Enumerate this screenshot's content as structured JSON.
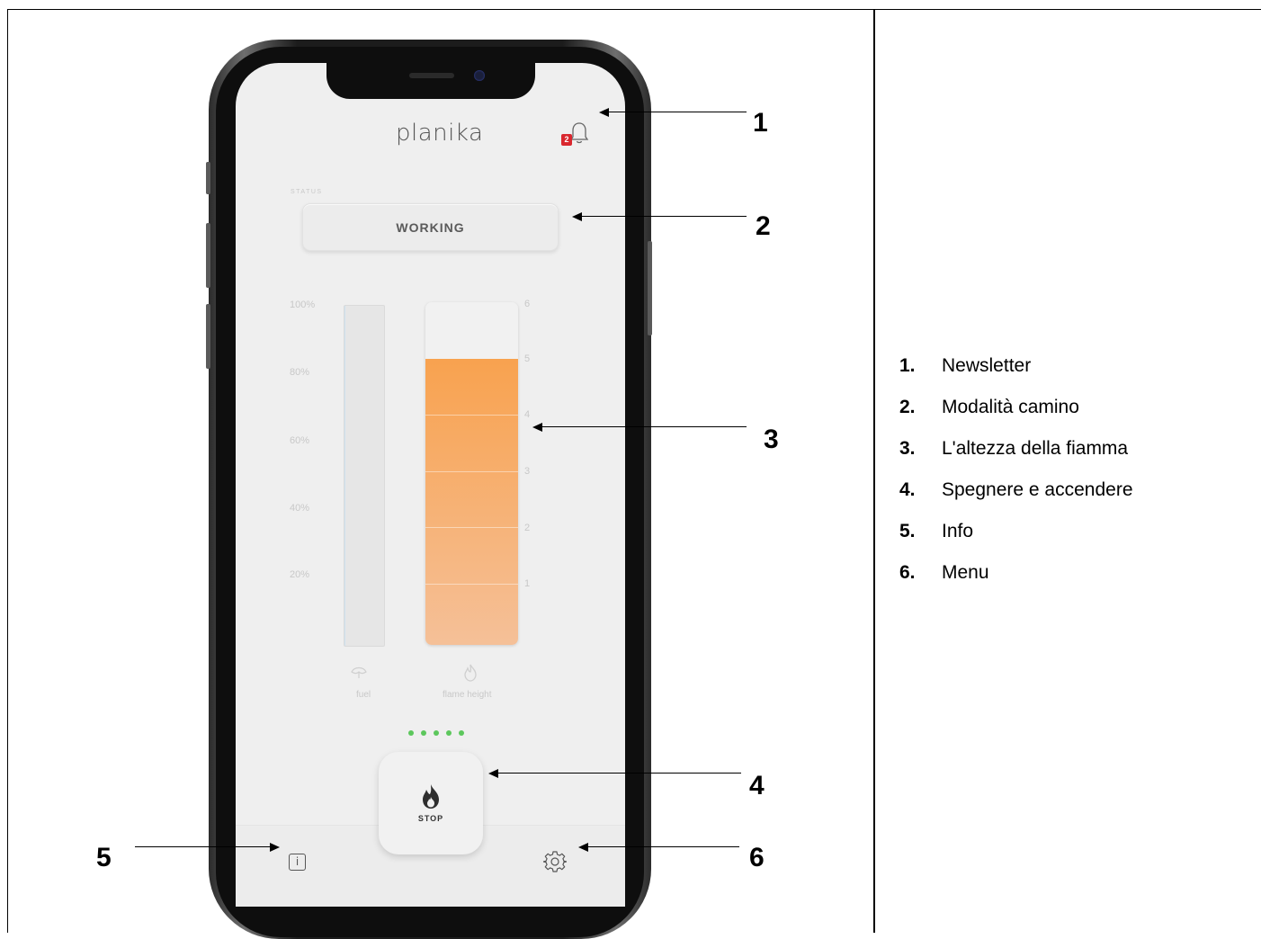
{
  "app": {
    "logo": "planika",
    "notification_count": "2",
    "status_label": "STATUS",
    "status_value": "WORKING",
    "fuel_ticks": [
      "100%",
      "80%",
      "60%",
      "40%",
      "20%"
    ],
    "flame_ticks": [
      "6",
      "5",
      "4",
      "3",
      "2",
      "1"
    ],
    "fuel_label": "fuel",
    "flame_label": "flame height",
    "fuel_level": 0,
    "flame_height": 5,
    "flame_max": 6,
    "stop_label": "STOP",
    "info_glyph": "i",
    "progress_dots": 5,
    "colors": {
      "flame_top": "#f8a24f",
      "flame_bottom": "#f5c098",
      "dot": "#5cc75c",
      "badge": "#d9272e"
    },
    "icons": [
      "bell-icon",
      "drop-icon",
      "flame-icon",
      "info-icon",
      "gear-icon"
    ]
  },
  "callouts": [
    "1",
    "2",
    "3",
    "4",
    "5",
    "6"
  ],
  "legend": [
    {
      "num": "1.",
      "text": "Newsletter"
    },
    {
      "num": "2.",
      "text": "Modalità camino"
    },
    {
      "num": "3.",
      "text": "L'altezza della fiamma"
    },
    {
      "num": "4.",
      "text": "Spegnere e accendere"
    },
    {
      "num": "5.",
      "text": "Info"
    },
    {
      "num": "6.",
      "text": "Menu"
    }
  ]
}
